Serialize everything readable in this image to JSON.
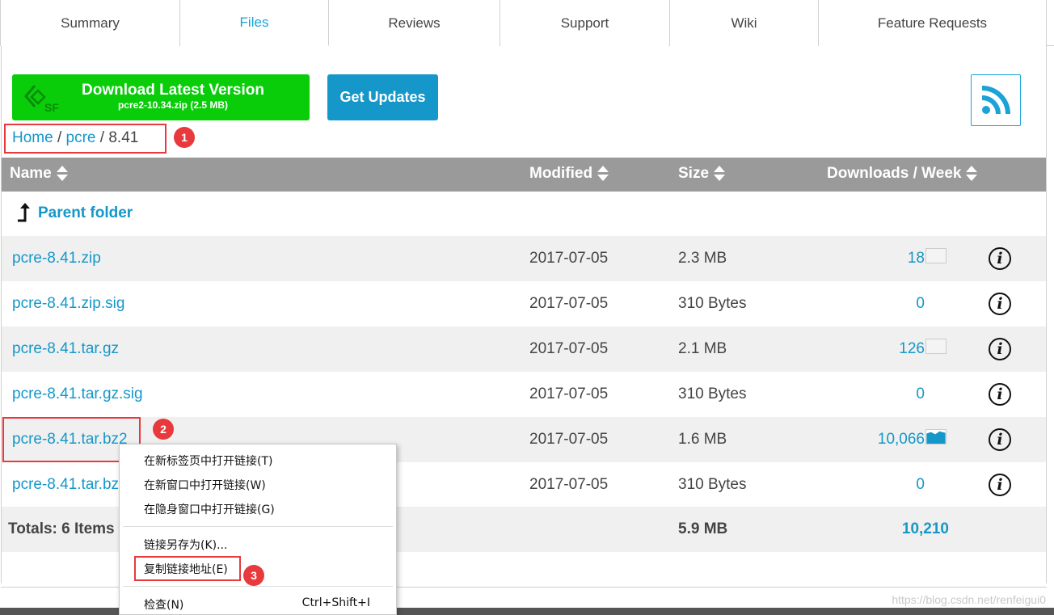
{
  "tabs": [
    "Summary",
    "Files",
    "Reviews",
    "Support",
    "Wiki",
    "Feature Requests"
  ],
  "download": {
    "title": "Download Latest Version",
    "subtitle": "pcre2-10.34.zip (2.5 MB)",
    "logo_text": "SF"
  },
  "get_updates": "Get Updates",
  "breadcrumb": {
    "home": "Home",
    "sep": "/",
    "project": "pcre",
    "current": "8.41"
  },
  "annotations": [
    "1",
    "2",
    "3"
  ],
  "table": {
    "headers": {
      "name": "Name",
      "modified": "Modified",
      "size": "Size",
      "downloads": "Downloads / Week"
    },
    "parent_folder": "Parent folder",
    "rows": [
      {
        "name": "pcre-8.41.zip",
        "modified": "2017-07-05",
        "size": "2.3 MB",
        "downloads": "18",
        "spark": "empty"
      },
      {
        "name": "pcre-8.41.zip.sig",
        "modified": "2017-07-05",
        "size": "310 Bytes",
        "downloads": "0",
        "spark": "none"
      },
      {
        "name": "pcre-8.41.tar.gz",
        "modified": "2017-07-05",
        "size": "2.1 MB",
        "downloads": "126",
        "spark": "empty"
      },
      {
        "name": "pcre-8.41.tar.gz.sig",
        "modified": "2017-07-05",
        "size": "310 Bytes",
        "downloads": "0",
        "spark": "none"
      },
      {
        "name": "pcre-8.41.tar.bz2",
        "modified": "2017-07-05",
        "size": "1.6 MB",
        "downloads": "10,066",
        "spark": "filled"
      },
      {
        "name": "pcre-8.41.tar.bz2.sig",
        "modified": "2017-07-05",
        "size": "310 Bytes",
        "downloads": "0",
        "spark": "none"
      }
    ],
    "totals": {
      "label": "Totals: 6 Items",
      "size": "5.9 MB",
      "downloads": "10,210"
    },
    "info_glyph": "i"
  },
  "context_menu": {
    "items": [
      "在新标签页中打开链接(T)",
      "在新窗口中打开链接(W)",
      "在隐身窗口中打开链接(G)",
      "链接另存为(K)...",
      "复制链接地址(E)",
      "检查(N)"
    ],
    "inspect_shortcut": "Ctrl+Shift+I"
  },
  "watermark": "https://blog.csdn.net/renfeigui0",
  "colors": {
    "green": "#09cd09",
    "blue": "#1597c9",
    "link": "#1597c9",
    "header": "#9a9a9a",
    "annotation": "#e8393d"
  }
}
